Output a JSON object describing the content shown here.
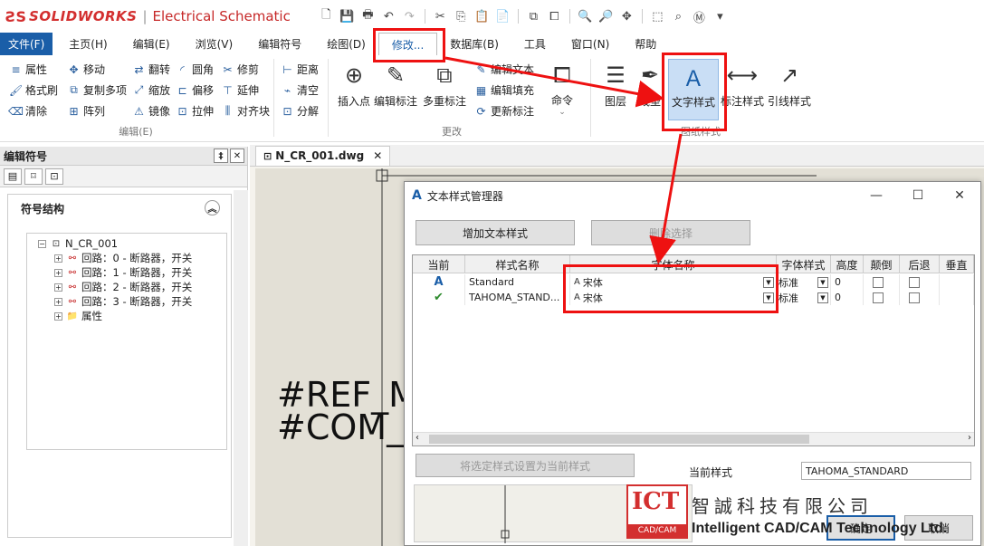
{
  "app": {
    "logo_brand": "SOLIDWORKS",
    "logo_sep": "|",
    "logo_product": "Electrical Schematic"
  },
  "menus": [
    "文件(F)",
    "主页(H)",
    "编辑(E)",
    "浏览(V)",
    "编辑符号",
    "绘图(D)",
    "修改...",
    "数据库(B)",
    "工具",
    "窗口(N)",
    "帮助"
  ],
  "ribbon": {
    "edit_items": [
      "属性",
      "移动",
      "翻转",
      "圆角",
      "修剪",
      "格式刷",
      "复制多项",
      "缩放",
      "偏移",
      "延伸",
      "清除",
      "阵列",
      "镜像",
      "拉伸",
      "对齐块"
    ],
    "edit_label": "编辑(E)",
    "dist_items": [
      "距离",
      "清空",
      "分解"
    ],
    "modify_items": [
      "插入点",
      "编辑标注",
      "多重标注"
    ],
    "modify_small": [
      "编辑文本",
      "编辑填充",
      "更新标注"
    ],
    "modify_label": "更改",
    "command": "命令",
    "style_items": [
      "图层",
      "线型",
      "文字样式",
      "标注样式",
      "引线样式"
    ],
    "style_label": "图纸样式"
  },
  "left_panel": {
    "title": "编辑符号",
    "pin": "‡",
    "close": "✕",
    "structure_title": "符号结构",
    "tree": [
      {
        "label": "N_CR_001",
        "level": 0,
        "exp": "−"
      },
      {
        "label": "回路：0 - 断路器，开关",
        "level": 1,
        "exp": "+"
      },
      {
        "label": "回路：1 - 断路器，开关",
        "level": 1,
        "exp": "+"
      },
      {
        "label": "回路：2 - 断路器，开关",
        "level": 1,
        "exp": "+"
      },
      {
        "label": "回路：3 - 断路器，开关",
        "level": 1,
        "exp": "+"
      },
      {
        "label": "属性",
        "level": 1,
        "exp": "+"
      }
    ]
  },
  "doc": {
    "tab": "N_CR_001.dwg",
    "close": "✕",
    "ref1": "#REF_MA",
    "ref2": "#COM_T"
  },
  "dialog": {
    "title": "文本样式管理器",
    "add_btn": "增加文本样式",
    "delete_btn": "删除选择",
    "set_btn": "将选定样式设置为当前样式",
    "current_label": "当前样式",
    "current_value": "TAHOMA_STANDARD",
    "ok": "确定",
    "cancel": "取消",
    "columns": [
      "当前",
      "样式名称",
      "字体名称",
      "字体样式",
      "高度",
      "颠倒",
      "后退",
      "垂直"
    ],
    "rows": [
      {
        "current": "style-icon",
        "name": "Standard",
        "font": "宋体",
        "style": "标准",
        "height": "0"
      },
      {
        "current": "check-icon",
        "name": "TAHOMA_STAND...",
        "font": "宋体",
        "style": "标准",
        "height": "0"
      }
    ]
  },
  "watermark": {
    "logo": "ICT",
    "logo_sub": "CAD/CAM",
    "cn": "智誠科技有限公司",
    "en": "Intelligent CAD/CAM Technology Ltd."
  },
  "colors": {
    "accent": "#1a5ea8",
    "highlight": "#e11111",
    "brand": "#d32f2f"
  }
}
